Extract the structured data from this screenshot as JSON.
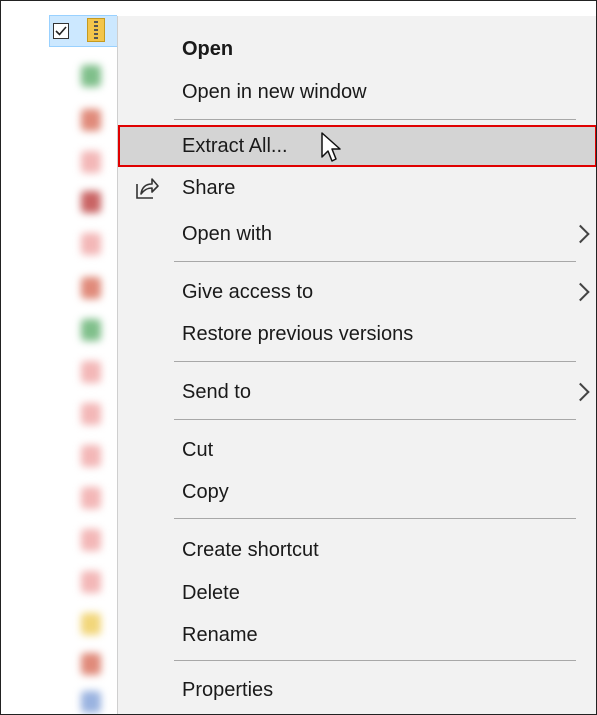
{
  "menu": {
    "items": [
      {
        "key": "open",
        "label": "Open"
      },
      {
        "key": "open-new-window",
        "label": "Open in new window"
      },
      {
        "key": "extract-all",
        "label": "Extract All..."
      },
      {
        "key": "share",
        "label": "Share",
        "icon": "share-icon"
      },
      {
        "key": "open-with",
        "label": "Open with",
        "submenu": true
      },
      {
        "key": "give-access",
        "label": "Give access to",
        "submenu": true
      },
      {
        "key": "restore-previous",
        "label": "Restore previous versions"
      },
      {
        "key": "send-to",
        "label": "Send to",
        "submenu": true
      },
      {
        "key": "cut",
        "label": "Cut"
      },
      {
        "key": "copy",
        "label": "Copy"
      },
      {
        "key": "create-shortcut",
        "label": "Create shortcut"
      },
      {
        "key": "delete",
        "label": "Delete"
      },
      {
        "key": "rename",
        "label": "Rename"
      },
      {
        "key": "properties",
        "label": "Properties"
      }
    ],
    "highlighted": "Extract All..."
  },
  "file_list": {
    "selected_item_icon": "zip-folder-icon",
    "selected_checkbox": "checked"
  },
  "colors": {
    "menu_bg": "#f2f2f2",
    "highlight_bg": "#d4d4d4",
    "highlight_border": "#e00000",
    "selection_bg": "#cce8ff"
  }
}
